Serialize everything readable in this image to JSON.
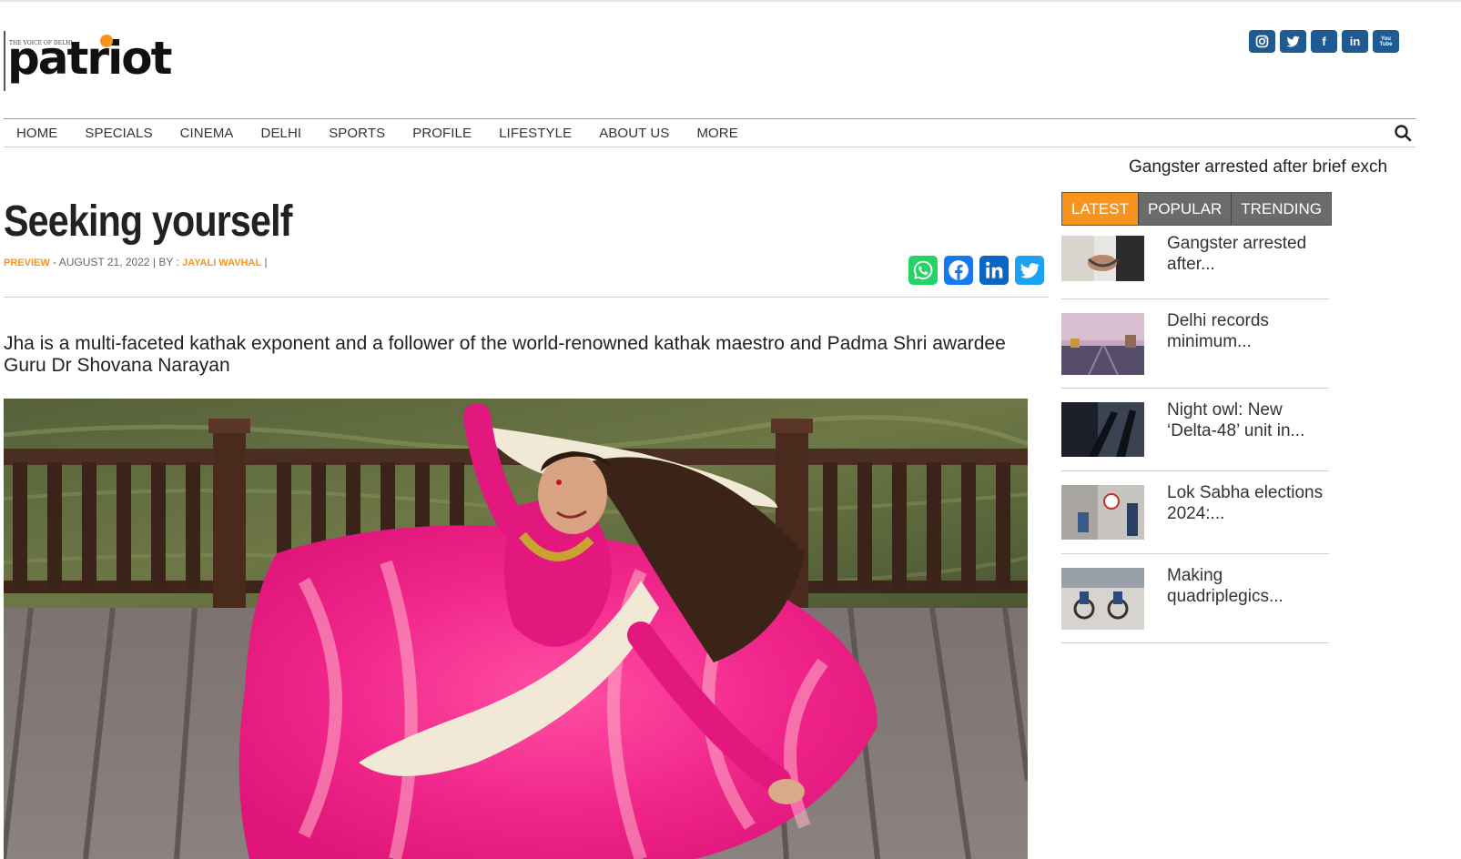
{
  "site": {
    "logo_tagline": "THE VOICE OF DELHI",
    "logo_word": "patriot"
  },
  "social": [
    {
      "name": "instagram",
      "label": ""
    },
    {
      "name": "twitter",
      "label": ""
    },
    {
      "name": "facebook",
      "label": "f"
    },
    {
      "name": "linkedin",
      "label": "in"
    },
    {
      "name": "youtube",
      "label": "You Tube"
    }
  ],
  "nav": {
    "items": [
      "HOME",
      "SPECIALS",
      "CINEMA",
      "DELHI",
      "SPORTS",
      "PROFILE",
      "LIFESTYLE",
      "ABOUT US",
      "MORE"
    ]
  },
  "ticker": {
    "text": "Gangster arrested after brief exch"
  },
  "article": {
    "title": "Seeking yourself",
    "category": "PREVIEW",
    "date_prefix": " - AUGUST 21, 2022 | BY : ",
    "author": "JAYALI WAVHAL",
    "author_suffix": " |",
    "summary": "Jha is a multi-faceted kathak exponent and a follower of the world-renowned kathak maestro and Padma Shri awardee Guru Dr Shovana Narayan"
  },
  "share": [
    {
      "name": "whatsapp",
      "color": "#25d366"
    },
    {
      "name": "facebook",
      "color": "#1877f2"
    },
    {
      "name": "linkedin",
      "color": "#0a66c2"
    },
    {
      "name": "twitter",
      "color": "#1da1f2"
    }
  ],
  "sidebar": {
    "tabs": [
      "LATEST",
      "POPULAR",
      "TRENDING"
    ],
    "active_tab": "LATEST",
    "items": [
      {
        "title": "Gangster arrested after..."
      },
      {
        "title": "Delhi records minimum..."
      },
      {
        "title": "Night owl: New ‘Delta-48’ unit in..."
      },
      {
        "title": "Lok Sabha elections 2024:..."
      },
      {
        "title": "Making quadriplegics..."
      }
    ]
  },
  "colors": {
    "accent": "#f7941d",
    "social_bg": "#1f5a92",
    "tab_bg": "#6b6b6b"
  }
}
